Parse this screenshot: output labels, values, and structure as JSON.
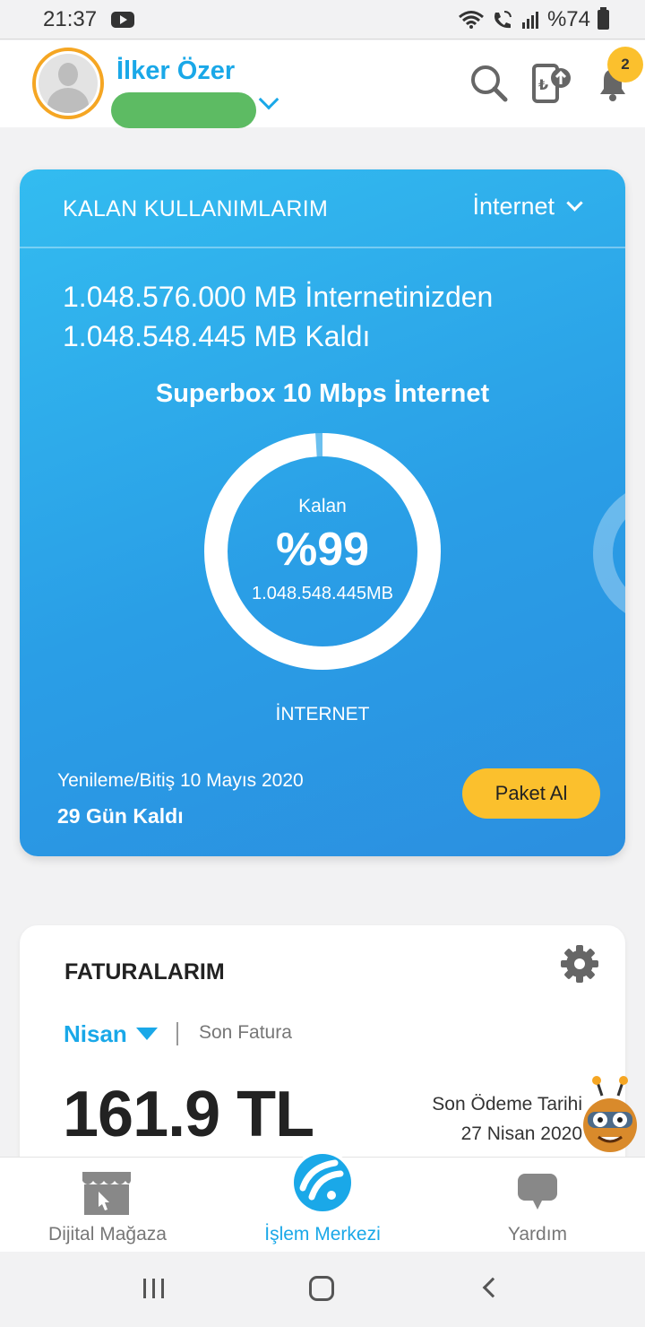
{
  "status_bar": {
    "time": "21:37",
    "battery": "%74"
  },
  "header": {
    "user_name": "İlker Özer",
    "notification_count": "2"
  },
  "usage_card": {
    "title": "KALAN KULLANIMLARIM",
    "type_selector": "İnternet",
    "total_line": "1.048.576.000 MB İnternetinizden",
    "remaining_line": "1.048.548.445 MB Kaldı",
    "package_name": "Superbox 10 Mbps İnternet",
    "gauge": {
      "label": "Kalan",
      "percent": "%99",
      "percent_value": 99,
      "amount": "1.048.548.445MB"
    },
    "usage_type": "İNTERNET",
    "renewal": "Yenileme/Bitiş 10 Mayıs 2020",
    "days_left": "29 Gün Kaldı",
    "buy_button": "Paket Al"
  },
  "bill_card": {
    "title": "FATURALARIM",
    "month": "Nisan",
    "last_bill_label": "Son Fatura",
    "amount": "161.9 TL",
    "due_label": "Son Ödeme Tarihi",
    "due_date": "27 Nisan 2020"
  },
  "bottom_nav": {
    "items": [
      {
        "label": "Dijital Mağaza",
        "icon": "store-icon"
      },
      {
        "label": "İşlem Merkezi",
        "icon": "turkcell-logo-icon"
      },
      {
        "label": "Yardım",
        "icon": "chat-bubble-icon"
      }
    ],
    "active_index": 1
  },
  "colors": {
    "accent": "#1aa8e8",
    "card_gradient_start": "#33bcf0",
    "card_gradient_end": "#2b8fe0",
    "button_yellow": "#fbc02d",
    "avatar_ring": "#f5a623"
  }
}
